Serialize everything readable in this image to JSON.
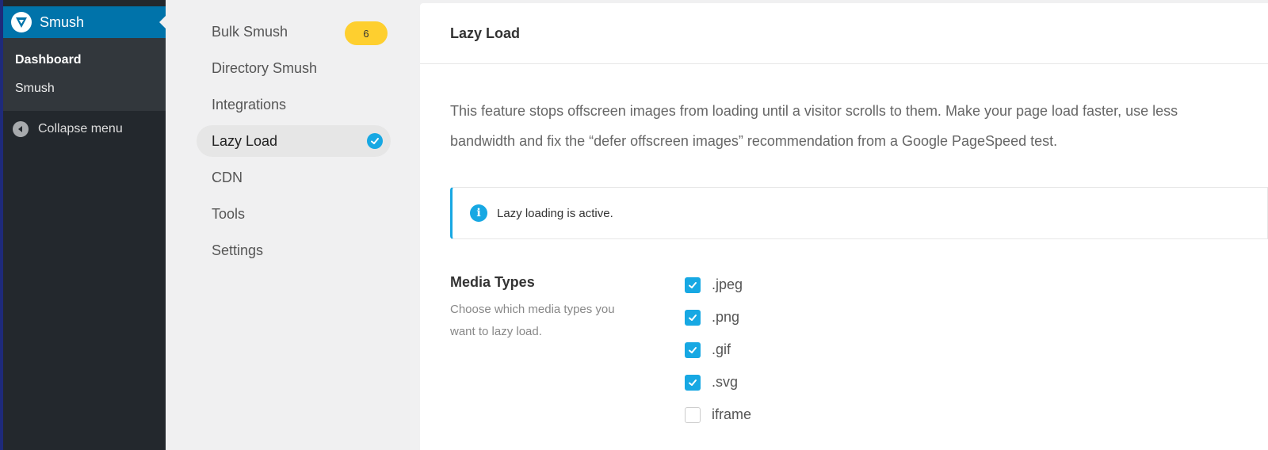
{
  "wp": {
    "smush_label": "Smush",
    "submenu": [
      "Dashboard",
      "Smush"
    ],
    "collapse_label": "Collapse menu"
  },
  "nav": {
    "items": [
      {
        "label": "Bulk Smush",
        "badge": "6"
      },
      {
        "label": "Directory Smush"
      },
      {
        "label": "Integrations"
      },
      {
        "label": "Lazy Load",
        "active": true
      },
      {
        "label": "CDN"
      },
      {
        "label": "Tools"
      },
      {
        "label": "Settings"
      }
    ]
  },
  "panel": {
    "title": "Lazy Load",
    "description": "This feature stops offscreen images from loading until a visitor scrolls to them. Make your page load faster, use less bandwidth and fix the “defer offscreen images” recommendation from a Google PageSpeed test.",
    "notice": "Lazy loading is active.",
    "media_types": {
      "title": "Media Types",
      "description": "Choose which media types you want to lazy load.",
      "options": [
        {
          "label": ".jpeg",
          "checked": true
        },
        {
          "label": ".png",
          "checked": true
        },
        {
          "label": ".gif",
          "checked": true
        },
        {
          "label": ".svg",
          "checked": true
        },
        {
          "label": "iframe",
          "checked": false
        }
      ]
    }
  },
  "colors": {
    "wp_blue": "#0073aa",
    "accent": "#17a8e3",
    "badge": "#fecf2f"
  }
}
